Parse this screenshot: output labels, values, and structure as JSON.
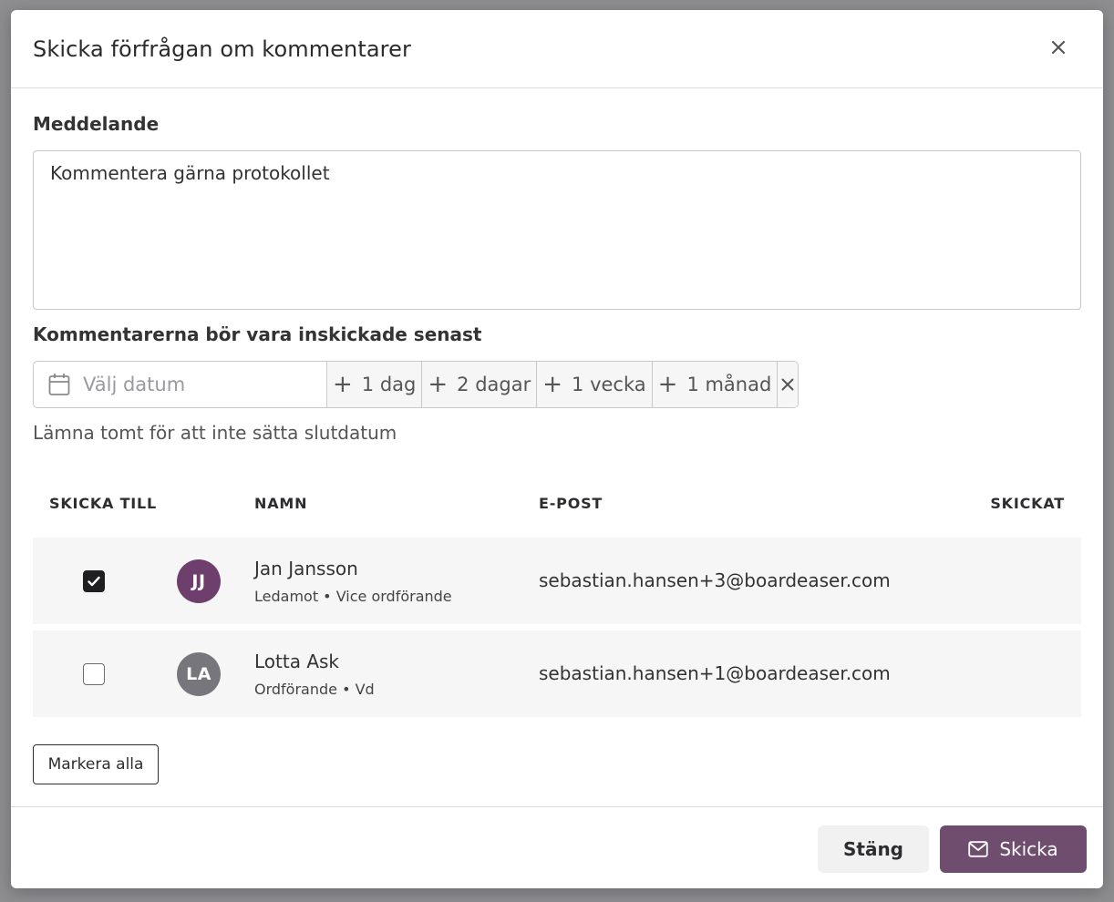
{
  "dialog": {
    "title": "Skicka förfrågan om kommentarer",
    "close_icon": "close-icon"
  },
  "message": {
    "label": "Meddelande",
    "value": "Kommentera gärna protokollet"
  },
  "deadline": {
    "label": "Kommentarerna bör vara inskickade senast",
    "date_placeholder": "Välj datum",
    "quick_options": [
      "1 dag",
      "2 dagar",
      "1 vecka",
      "1 månad"
    ],
    "clear_icon": "clear-icon",
    "hint": "Lämna tomt för att inte sätta slutdatum"
  },
  "table": {
    "headers": {
      "send_to": "SKICKA TILL",
      "name": "NAMN",
      "email": "E-POST",
      "sent": "SKICKAT"
    },
    "rows": [
      {
        "checked": true,
        "initials": "JJ",
        "avatar_color": "#6e3f6d",
        "name": "Jan Jansson",
        "role": "Ledamot • Vice ordförande",
        "email": "sebastian.hansen+3@boardeaser.com",
        "sent": ""
      },
      {
        "checked": false,
        "initials": "LA",
        "avatar_color": "#77767d",
        "name": "Lotta Ask",
        "role": "Ordförande • Vd",
        "email": "sebastian.hansen+1@boardeaser.com",
        "sent": ""
      }
    ]
  },
  "actions": {
    "mark_all": "Markera alla",
    "close": "Stäng",
    "send": "Skicka",
    "send_icon": "envelope-icon",
    "accent_color": "#6f4d6e"
  }
}
